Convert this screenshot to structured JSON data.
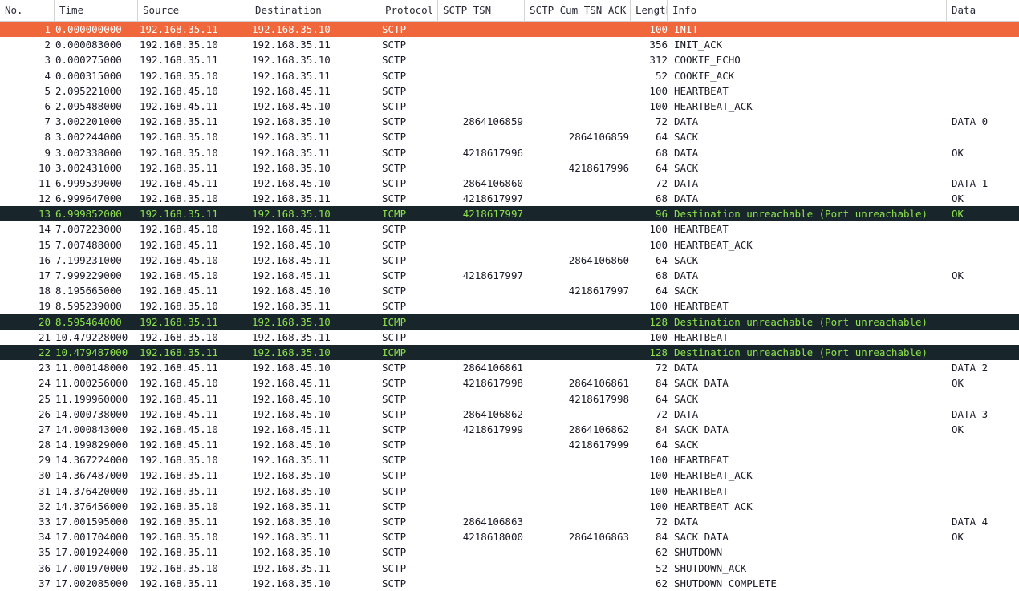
{
  "table": {
    "columns": [
      {
        "key": "no",
        "label": "No."
      },
      {
        "key": "time",
        "label": "Time"
      },
      {
        "key": "src",
        "label": "Source"
      },
      {
        "key": "dst",
        "label": "Destination"
      },
      {
        "key": "proto",
        "label": "Protocol"
      },
      {
        "key": "tsn",
        "label": "SCTP TSN"
      },
      {
        "key": "cumack",
        "label": "SCTP Cum TSN ACK"
      },
      {
        "key": "len",
        "label": "Length"
      },
      {
        "key": "info",
        "label": "Info"
      },
      {
        "key": "data",
        "label": "Data"
      }
    ],
    "colors": {
      "selected_background": "#f0673c",
      "selected_text": "#ffffff",
      "icmp_background": "#18262c",
      "icmp_text": "#8ce14b",
      "default_background": "#ffffff",
      "default_text": "#1b1b28",
      "header_border": "#d4d4d4"
    },
    "rows": [
      {
        "no": "1",
        "time": "0.000000000",
        "src": "192.168.35.11",
        "dst": "192.168.35.10",
        "proto": "SCTP",
        "tsn": "",
        "cumack": "",
        "len": "100",
        "info": "INIT",
        "data": "",
        "state": "selected"
      },
      {
        "no": "2",
        "time": "0.000083000",
        "src": "192.168.35.10",
        "dst": "192.168.35.11",
        "proto": "SCTP",
        "tsn": "",
        "cumack": "",
        "len": "356",
        "info": "INIT_ACK",
        "data": "",
        "state": "normal"
      },
      {
        "no": "3",
        "time": "0.000275000",
        "src": "192.168.35.11",
        "dst": "192.168.35.10",
        "proto": "SCTP",
        "tsn": "",
        "cumack": "",
        "len": "312",
        "info": "COOKIE_ECHO",
        "data": "",
        "state": "normal"
      },
      {
        "no": "4",
        "time": "0.000315000",
        "src": "192.168.35.10",
        "dst": "192.168.35.11",
        "proto": "SCTP",
        "tsn": "",
        "cumack": "",
        "len": "52",
        "info": "COOKIE_ACK",
        "data": "",
        "state": "normal"
      },
      {
        "no": "5",
        "time": "2.095221000",
        "src": "192.168.45.10",
        "dst": "192.168.45.11",
        "proto": "SCTP",
        "tsn": "",
        "cumack": "",
        "len": "100",
        "info": "HEARTBEAT",
        "data": "",
        "state": "normal"
      },
      {
        "no": "6",
        "time": "2.095488000",
        "src": "192.168.45.11",
        "dst": "192.168.45.10",
        "proto": "SCTP",
        "tsn": "",
        "cumack": "",
        "len": "100",
        "info": "HEARTBEAT_ACK",
        "data": "",
        "state": "normal"
      },
      {
        "no": "7",
        "time": "3.002201000",
        "src": "192.168.35.11",
        "dst": "192.168.35.10",
        "proto": "SCTP",
        "tsn": "2864106859",
        "cumack": "",
        "len": "72",
        "info": "DATA",
        "data": "DATA 0",
        "state": "normal"
      },
      {
        "no": "8",
        "time": "3.002244000",
        "src": "192.168.35.10",
        "dst": "192.168.35.11",
        "proto": "SCTP",
        "tsn": "",
        "cumack": "2864106859",
        "len": "64",
        "info": "SACK",
        "data": "",
        "state": "normal"
      },
      {
        "no": "9",
        "time": "3.002338000",
        "src": "192.168.35.10",
        "dst": "192.168.35.11",
        "proto": "SCTP",
        "tsn": "4218617996",
        "cumack": "",
        "len": "68",
        "info": "DATA",
        "data": "OK",
        "state": "normal"
      },
      {
        "no": "10",
        "time": "3.002431000",
        "src": "192.168.35.11",
        "dst": "192.168.35.10",
        "proto": "SCTP",
        "tsn": "",
        "cumack": "4218617996",
        "len": "64",
        "info": "SACK",
        "data": "",
        "state": "normal"
      },
      {
        "no": "11",
        "time": "6.999539000",
        "src": "192.168.45.11",
        "dst": "192.168.45.10",
        "proto": "SCTP",
        "tsn": "2864106860",
        "cumack": "",
        "len": "72",
        "info": "DATA",
        "data": "DATA 1",
        "state": "normal"
      },
      {
        "no": "12",
        "time": "6.999647000",
        "src": "192.168.35.10",
        "dst": "192.168.35.11",
        "proto": "SCTP",
        "tsn": "4218617997",
        "cumack": "",
        "len": "68",
        "info": "DATA",
        "data": "OK",
        "state": "normal"
      },
      {
        "no": "13",
        "time": "6.999852000",
        "src": "192.168.35.11",
        "dst": "192.168.35.10",
        "proto": "ICMP",
        "tsn": "4218617997",
        "cumack": "",
        "len": "96",
        "info": "Destination unreachable (Port unreachable)",
        "data": "OK",
        "state": "icmp"
      },
      {
        "no": "14",
        "time": "7.007223000",
        "src": "192.168.45.10",
        "dst": "192.168.45.11",
        "proto": "SCTP",
        "tsn": "",
        "cumack": "",
        "len": "100",
        "info": "HEARTBEAT",
        "data": "",
        "state": "normal"
      },
      {
        "no": "15",
        "time": "7.007488000",
        "src": "192.168.45.11",
        "dst": "192.168.45.10",
        "proto": "SCTP",
        "tsn": "",
        "cumack": "",
        "len": "100",
        "info": "HEARTBEAT_ACK",
        "data": "",
        "state": "normal"
      },
      {
        "no": "16",
        "time": "7.199231000",
        "src": "192.168.45.10",
        "dst": "192.168.45.11",
        "proto": "SCTP",
        "tsn": "",
        "cumack": "2864106860",
        "len": "64",
        "info": "SACK",
        "data": "",
        "state": "normal"
      },
      {
        "no": "17",
        "time": "7.999229000",
        "src": "192.168.45.10",
        "dst": "192.168.45.11",
        "proto": "SCTP",
        "tsn": "4218617997",
        "cumack": "",
        "len": "68",
        "info": "DATA",
        "data": "OK",
        "state": "normal"
      },
      {
        "no": "18",
        "time": "8.195665000",
        "src": "192.168.45.11",
        "dst": "192.168.45.10",
        "proto": "SCTP",
        "tsn": "",
        "cumack": "4218617997",
        "len": "64",
        "info": "SACK",
        "data": "",
        "state": "normal"
      },
      {
        "no": "19",
        "time": "8.595239000",
        "src": "192.168.35.10",
        "dst": "192.168.35.11",
        "proto": "SCTP",
        "tsn": "",
        "cumack": "",
        "len": "100",
        "info": "HEARTBEAT",
        "data": "",
        "state": "normal"
      },
      {
        "no": "20",
        "time": "8.595464000",
        "src": "192.168.35.11",
        "dst": "192.168.35.10",
        "proto": "ICMP",
        "tsn": "",
        "cumack": "",
        "len": "128",
        "info": "Destination unreachable (Port unreachable)",
        "data": "",
        "state": "icmp"
      },
      {
        "no": "21",
        "time": "10.479228000",
        "src": "192.168.35.10",
        "dst": "192.168.35.11",
        "proto": "SCTP",
        "tsn": "",
        "cumack": "",
        "len": "100",
        "info": "HEARTBEAT",
        "data": "",
        "state": "normal"
      },
      {
        "no": "22",
        "time": "10.479487000",
        "src": "192.168.35.11",
        "dst": "192.168.35.10",
        "proto": "ICMP",
        "tsn": "",
        "cumack": "",
        "len": "128",
        "info": "Destination unreachable (Port unreachable)",
        "data": "",
        "state": "icmp"
      },
      {
        "no": "23",
        "time": "11.000148000",
        "src": "192.168.45.11",
        "dst": "192.168.45.10",
        "proto": "SCTP",
        "tsn": "2864106861",
        "cumack": "",
        "len": "72",
        "info": "DATA",
        "data": "DATA 2",
        "state": "normal"
      },
      {
        "no": "24",
        "time": "11.000256000",
        "src": "192.168.45.10",
        "dst": "192.168.45.11",
        "proto": "SCTP",
        "tsn": "4218617998",
        "cumack": "2864106861",
        "len": "84",
        "info": "SACK DATA",
        "data": "OK",
        "state": "normal"
      },
      {
        "no": "25",
        "time": "11.199960000",
        "src": "192.168.45.11",
        "dst": "192.168.45.10",
        "proto": "SCTP",
        "tsn": "",
        "cumack": "4218617998",
        "len": "64",
        "info": "SACK",
        "data": "",
        "state": "normal"
      },
      {
        "no": "26",
        "time": "14.000738000",
        "src": "192.168.45.11",
        "dst": "192.168.45.10",
        "proto": "SCTP",
        "tsn": "2864106862",
        "cumack": "",
        "len": "72",
        "info": "DATA",
        "data": "DATA 3",
        "state": "normal"
      },
      {
        "no": "27",
        "time": "14.000843000",
        "src": "192.168.45.10",
        "dst": "192.168.45.11",
        "proto": "SCTP",
        "tsn": "4218617999",
        "cumack": "2864106862",
        "len": "84",
        "info": "SACK DATA",
        "data": "OK",
        "state": "normal"
      },
      {
        "no": "28",
        "time": "14.199829000",
        "src": "192.168.45.11",
        "dst": "192.168.45.10",
        "proto": "SCTP",
        "tsn": "",
        "cumack": "4218617999",
        "len": "64",
        "info": "SACK",
        "data": "",
        "state": "normal"
      },
      {
        "no": "29",
        "time": "14.367224000",
        "src": "192.168.35.10",
        "dst": "192.168.35.11",
        "proto": "SCTP",
        "tsn": "",
        "cumack": "",
        "len": "100",
        "info": "HEARTBEAT",
        "data": "",
        "state": "normal"
      },
      {
        "no": "30",
        "time": "14.367487000",
        "src": "192.168.35.11",
        "dst": "192.168.35.10",
        "proto": "SCTP",
        "tsn": "",
        "cumack": "",
        "len": "100",
        "info": "HEARTBEAT_ACK",
        "data": "",
        "state": "normal"
      },
      {
        "no": "31",
        "time": "14.376420000",
        "src": "192.168.35.11",
        "dst": "192.168.35.10",
        "proto": "SCTP",
        "tsn": "",
        "cumack": "",
        "len": "100",
        "info": "HEARTBEAT",
        "data": "",
        "state": "normal"
      },
      {
        "no": "32",
        "time": "14.376456000",
        "src": "192.168.35.10",
        "dst": "192.168.35.11",
        "proto": "SCTP",
        "tsn": "",
        "cumack": "",
        "len": "100",
        "info": "HEARTBEAT_ACK",
        "data": "",
        "state": "normal"
      },
      {
        "no": "33",
        "time": "17.001595000",
        "src": "192.168.35.11",
        "dst": "192.168.35.10",
        "proto": "SCTP",
        "tsn": "2864106863",
        "cumack": "",
        "len": "72",
        "info": "DATA",
        "data": "DATA 4",
        "state": "normal"
      },
      {
        "no": "34",
        "time": "17.001704000",
        "src": "192.168.35.10",
        "dst": "192.168.35.11",
        "proto": "SCTP",
        "tsn": "4218618000",
        "cumack": "2864106863",
        "len": "84",
        "info": "SACK DATA",
        "data": "OK",
        "state": "normal"
      },
      {
        "no": "35",
        "time": "17.001924000",
        "src": "192.168.35.11",
        "dst": "192.168.35.10",
        "proto": "SCTP",
        "tsn": "",
        "cumack": "",
        "len": "62",
        "info": "SHUTDOWN",
        "data": "",
        "state": "normal"
      },
      {
        "no": "36",
        "time": "17.001970000",
        "src": "192.168.35.10",
        "dst": "192.168.35.11",
        "proto": "SCTP",
        "tsn": "",
        "cumack": "",
        "len": "52",
        "info": "SHUTDOWN_ACK",
        "data": "",
        "state": "normal"
      },
      {
        "no": "37",
        "time": "17.002085000",
        "src": "192.168.35.11",
        "dst": "192.168.35.10",
        "proto": "SCTP",
        "tsn": "",
        "cumack": "",
        "len": "62",
        "info": "SHUTDOWN_COMPLETE",
        "data": "",
        "state": "normal"
      }
    ]
  }
}
